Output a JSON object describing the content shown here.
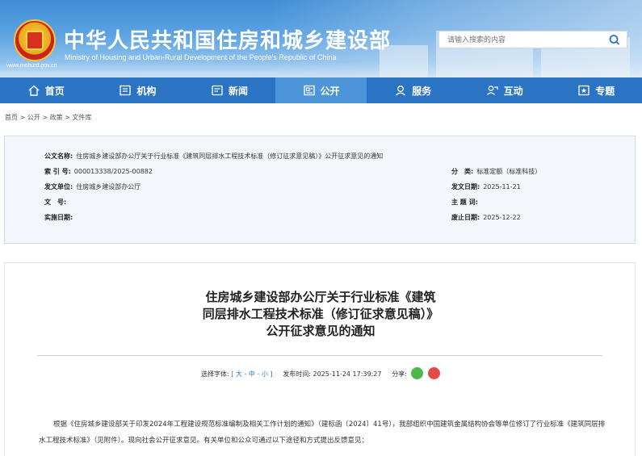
{
  "header": {
    "title": "中华人民共和国住房和城乡建设部",
    "subtitle": "Ministry of Housing and Urban-Rural Development of the People's Republic of China",
    "url": "www.mohurd.gov.cn",
    "search_placeholder": "请输入搜索的内容"
  },
  "nav": {
    "items": [
      {
        "label": "首页",
        "icon": "home-icon"
      },
      {
        "label": "机构",
        "icon": "org-icon"
      },
      {
        "label": "新闻",
        "icon": "news-icon"
      },
      {
        "label": "公开",
        "icon": "disclosure-icon",
        "active": true
      },
      {
        "label": "服务",
        "icon": "service-icon"
      },
      {
        "label": "互动",
        "icon": "interact-icon"
      },
      {
        "label": "专题",
        "icon": "topic-icon"
      }
    ]
  },
  "breadcrumb": [
    "首页",
    "公开",
    "政策",
    "文件库"
  ],
  "info": {
    "doc_name_label": "公文名称:",
    "doc_name": "住房城乡建设部办公厅关于行业标准《建筑同层排水工程技术标准（修订征求意见稿）》公开征求意见的通知",
    "index_label": "索 引 号:",
    "index": "000013338/2025-00882",
    "category_label": "分　类:",
    "category": "标准定额（标准科技）",
    "issuer_label": "发文单位:",
    "issuer": "住房城乡建设部办公厅",
    "issue_date_label": "发文日期:",
    "issue_date": "2025-11-21",
    "doc_no_label": "文　号:",
    "doc_no": "",
    "subject_label": "主 题 词:",
    "subject": "",
    "effective_label": "实施日期:",
    "effective": "",
    "expiry_label": "废止日期:",
    "expiry": "2025-12-22"
  },
  "article": {
    "title_line1": "住房城乡建设部办公厅关于行业标准《建筑",
    "title_line2": "同层排水工程技术标准（修订征求意见稿）》",
    "title_line3": "公开征求意见的通知",
    "font_label": "选择字体:",
    "font_sizes": "[ 大 - 中 - 小 ]",
    "publish_label": "发布时间:",
    "publish_time": "2025-11-24 17:39:27",
    "share_label": "分享:",
    "body": "根据《住房城乡建设部关于印发2024年工程建设规范标准编制及相关工作计划的通知》（建标函〔2024〕41号），我部组织中国建筑金属结构协会等单位修订了行业标准《建筑同层排水工程技术标准》（见附件）。现向社会公开征求意见。有关单位和公众可通过以下途径和方式提出反馈意见："
  },
  "colors": {
    "nav_bg": "#2b74c4",
    "nav_active": "#4d95d9",
    "info_bg": "#f3f7fb"
  }
}
